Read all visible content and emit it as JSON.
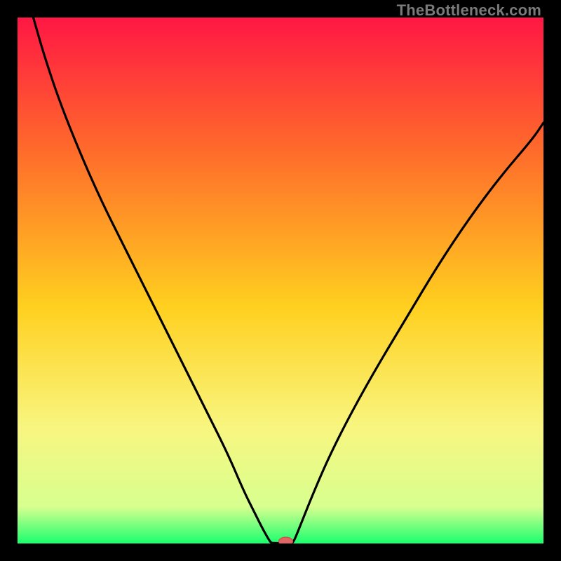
{
  "watermark": "TheBottleneck.com",
  "chart_data": {
    "type": "line",
    "title": "",
    "xlabel": "",
    "ylabel": "",
    "xlim": [
      0,
      100
    ],
    "ylim": [
      0,
      100
    ],
    "grid": false,
    "legend": false,
    "background": {
      "description": "vertical gradient from red (top) through orange, yellow, to green (bottom)",
      "stops": [
        {
          "offset": 0,
          "color": "#ff1744"
        },
        {
          "offset": 25,
          "color": "#ff6a2b"
        },
        {
          "offset": 55,
          "color": "#ffd01f"
        },
        {
          "offset": 78,
          "color": "#f8f680"
        },
        {
          "offset": 93,
          "color": "#d8ff8f"
        },
        {
          "offset": 100,
          "color": "#1aff6e"
        }
      ]
    },
    "series": [
      {
        "name": "bottleneck-curve",
        "color": "#000000",
        "x": [
          3,
          5,
          8,
          12,
          16,
          20,
          24,
          28,
          32,
          36,
          40,
          43,
          45,
          46.5,
          47.5,
          48,
          48.2,
          48.4,
          50,
          52,
          52.2,
          52.5,
          53,
          54,
          56,
          59,
          63,
          68,
          74,
          80,
          86,
          92,
          98,
          100
        ],
        "y": [
          100,
          93,
          84,
          74,
          65,
          57,
          49,
          41,
          33,
          25,
          17,
          10,
          6,
          3,
          1.2,
          0.4,
          0.2,
          0.1,
          0.05,
          0.05,
          0.1,
          0.4,
          1.5,
          4,
          9,
          16,
          24,
          33,
          43,
          53,
          62,
          70,
          77,
          80
        ]
      }
    ],
    "marker": {
      "description": "small red lozenge at curve minimum",
      "x": 51,
      "y": 0.4,
      "color": "#e06666",
      "rx": 10,
      "ry": 6
    }
  }
}
